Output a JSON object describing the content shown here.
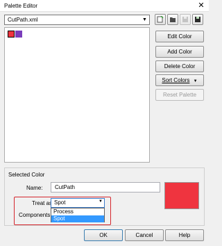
{
  "window": {
    "title": "Palette Editor",
    "close_glyph": "✕"
  },
  "file_combo": {
    "value": "CutPath.xml",
    "icon": "chevron-down-icon"
  },
  "toolbar": [
    {
      "name": "new-palette-icon",
      "enabled": true
    },
    {
      "name": "open-folder-icon",
      "enabled": true
    },
    {
      "name": "save-icon",
      "enabled": false
    },
    {
      "name": "save-as-icon",
      "enabled": true
    }
  ],
  "swatches": [
    {
      "color": "#ef343f",
      "selected": true
    },
    {
      "color": "#7a3dbb",
      "selected": false
    }
  ],
  "side_buttons": {
    "edit": "Edit Color",
    "add": "Add Color",
    "delete": "Delete Color",
    "sort": "Sort Colors",
    "reset": "Reset Palette"
  },
  "selected_color": {
    "group_label": "Selected Color",
    "name_label": "Name:",
    "name_value": "CutPath",
    "treat_label": "Treat as:",
    "treat_value": "Spot",
    "components_label": "Components:",
    "treat_options": [
      "Process",
      "Spot"
    ],
    "preview_color": "#ef343f"
  },
  "footer": {
    "ok": "OK",
    "cancel": "Cancel",
    "help": "Help"
  },
  "colors": {
    "highlight": "#d4252c",
    "selection": "#3399ff"
  }
}
